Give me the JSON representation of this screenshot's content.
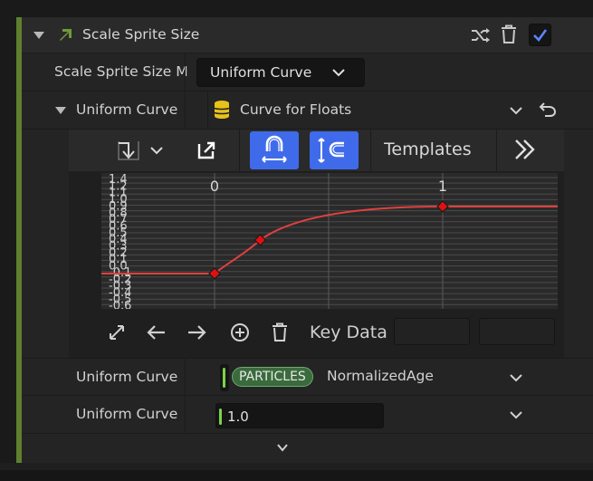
{
  "module": {
    "title": "Scale Sprite Size",
    "enabled": true
  },
  "mode_row": {
    "label": "Scale Sprite Size M",
    "value": "Uniform Curve"
  },
  "curve_row": {
    "label": "Uniform Curve S",
    "value": "Curve for Floats"
  },
  "curve_editor": {
    "templates_label": "Templates",
    "key_data_label": "Key Data",
    "x_axis_labels": [
      "0",
      "1"
    ],
    "y_axis_labels": [
      "1.4",
      "1.2",
      "1.1",
      "1.0",
      "0.9",
      "0.8",
      "0.7",
      "0.6",
      "0.5",
      "0.4",
      "0.3",
      "0.2",
      "0.1",
      "0.0",
      "-0.1",
      "-0.2",
      "-0.3",
      "-0.4",
      "-0.5",
      "-0.6"
    ],
    "keys": [
      {
        "time": 0.0,
        "value": 0.0
      },
      {
        "time": 0.2,
        "value": 0.5
      },
      {
        "time": 1.0,
        "value": 1.0
      }
    ],
    "colors": {
      "curve": "#e04040",
      "key": "#e01010",
      "accent": "#3f6bea"
    }
  },
  "index_row": {
    "label": "Uniform Curve I",
    "badge": "PARTICLES",
    "value": "NormalizedAge"
  },
  "scale_row": {
    "label": "Uniform Curve S",
    "value": "1.0"
  }
}
